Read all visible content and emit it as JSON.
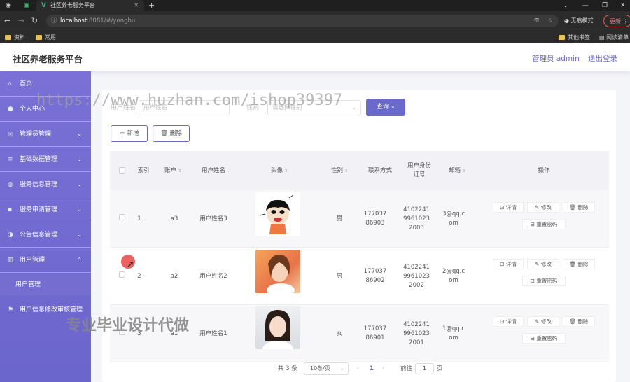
{
  "browser": {
    "tab_title": "社区养老服务平台",
    "url_host": "localhost",
    "url_path": ":8081/#/yonghu",
    "incognito_label": "无痕模式",
    "update_label": "更新",
    "bookmarks": [
      "资料",
      "常用"
    ],
    "bookmarks_right": [
      "其他书签",
      "阅读清单"
    ]
  },
  "header": {
    "brand": "社区养老服务平台",
    "admin_label": "管理员 admin",
    "logout_label": "退出登录"
  },
  "sidebar": {
    "items": [
      {
        "label": "首页",
        "icon": "home-icon",
        "chevron": ""
      },
      {
        "label": "个人中心",
        "icon": "user-icon",
        "chevron": ""
      },
      {
        "label": "管理员管理",
        "icon": "admin-icon",
        "chevron": "⌄"
      },
      {
        "label": "基础数据管理",
        "icon": "list-icon",
        "chevron": "⌄"
      },
      {
        "label": "服务信息管理",
        "icon": "info-icon",
        "chevron": "⌄"
      },
      {
        "label": "服务申请管理",
        "icon": "apply-icon",
        "chevron": "⌄"
      },
      {
        "label": "公告信息管理",
        "icon": "notice-icon",
        "chevron": "⌄"
      },
      {
        "label": "用户管理",
        "icon": "users-icon",
        "chevron": "⌃"
      },
      {
        "label": "用户信息修改审核管理",
        "icon": "flag-icon",
        "chevron": ""
      }
    ],
    "sub_item": "用户管理"
  },
  "search": {
    "field1_label": "用户姓名",
    "field1_placeholder": "用户姓名",
    "field2_label": "性别",
    "field2_placeholder": "请选择性别",
    "query_label": "查询"
  },
  "actions": {
    "add": "新增",
    "delete": "删除"
  },
  "table": {
    "headers": {
      "index": "索引",
      "account": "账户",
      "name": "用户姓名",
      "avatar": "头像",
      "gender": "性别",
      "phone": "联系方式",
      "id_card": "用户身份证号",
      "email": "邮箱",
      "ops": "操作"
    },
    "rows": [
      {
        "index": "1",
        "account": "a3",
        "name": "用户姓名3",
        "gender": "男",
        "phone": "17703786903",
        "id_card": "410224199610232003",
        "email": "3@qq.com",
        "avatar": "cartoon"
      },
      {
        "index": "2",
        "account": "a2",
        "name": "用户姓名2",
        "gender": "男",
        "phone": "17703786902",
        "id_card": "410224199610232002",
        "email": "2@qq.com",
        "avatar": "photo-orange"
      },
      {
        "index": "3",
        "account": "a1",
        "name": "用户姓名1",
        "gender": "女",
        "phone": "17703786901",
        "id_card": "410224199610232001",
        "email": "1@qq.com",
        "avatar": "photo-white"
      }
    ],
    "btn_detail": "详情",
    "btn_edit": "修改",
    "btn_delete": "删除",
    "btn_reset": "重置密码"
  },
  "pagination": {
    "total": "共 3 条",
    "page_size": "10条/页",
    "current": "1",
    "goto_label": "前往",
    "goto_value": "1",
    "page_unit": "页"
  },
  "watermarks": {
    "url": "https://www.huzhan.com/ishop39397",
    "caption": "专业毕业设计代做"
  },
  "colors": {
    "accent": "#6a6acc",
    "sidebar": "#7a70d6"
  }
}
